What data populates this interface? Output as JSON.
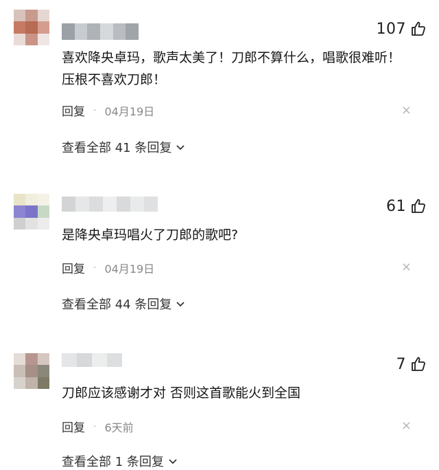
{
  "comments": [
    {
      "likes": "107",
      "text": "喜欢降央卓玛，歌声太美了！刀郎不算什么，唱歌很难听！压根不喜欢刀郎！",
      "reply_label": "回复",
      "separator": "·",
      "date": "04月19日",
      "close": "×",
      "view_all": "查看全部 41 条回复"
    },
    {
      "likes": "61",
      "text": "是降央卓玛唱火了刀郎的歌吧?",
      "reply_label": "回复",
      "separator": "·",
      "date": "04月19日",
      "close": "×",
      "view_all": "查看全部 44 条回复"
    },
    {
      "likes": "7",
      "text": "刀郎应该感谢才对 否则这首歌能火到全国",
      "reply_label": "回复",
      "separator": "·",
      "date": "6天前",
      "close": "×",
      "view_all": "查看全部 1 条回复"
    }
  ],
  "icons": {
    "like": "thumbs-up-icon",
    "close": "close-icon",
    "expand": "chevron-down-icon"
  },
  "colors": {
    "text": "#161616",
    "meta": "#888888",
    "close": "#b5b5b5"
  }
}
